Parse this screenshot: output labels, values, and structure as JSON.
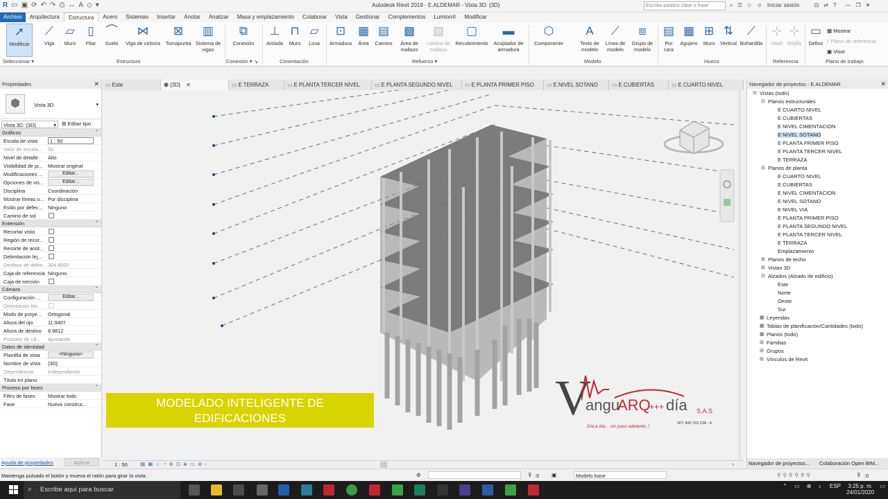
{
  "app": {
    "title": "Autodesk Revit 2019 - E.ALDEMAR - Vista 3D: {3D}",
    "search_placeholder": "Escriba palabra clave o frase",
    "sign_in": "Iniciar sesión"
  },
  "menu": [
    "Archivo",
    "Arquitectura",
    "Estructura",
    "Acero",
    "Sistemas",
    "Insertar",
    "Anotar",
    "Analizar",
    "Masa y emplazamiento",
    "Colaborar",
    "Vista",
    "Gestionar",
    "Complementos",
    "Lumion®",
    "Modificar"
  ],
  "ribbon": {
    "tools": [
      "Modificar",
      "Viga",
      "Muro",
      "Pilar",
      "Suelo",
      "Viga de celosía",
      "Tornapunta",
      "Sistema de vigas",
      "Conexión",
      "Aislada",
      "Muro",
      "Losa",
      "Armadura",
      "Área",
      "Camino",
      "Área de mallazo",
      "Lámina de mallazo",
      "Recubrimiento",
      "Acoplador de armadura",
      "Componente",
      "Texto de modelo",
      "Línea de modelo",
      "Grupo de modelo",
      "Por cara",
      "Agujero",
      "Muro",
      "Vertical",
      "Buhardilla",
      "Nivel",
      "Rejilla",
      "Definir",
      "Mostrar",
      "Plano de referencia",
      "Visor"
    ],
    "groups": [
      "Seleccionar",
      "Estructura",
      "Conexión",
      "Cimentación",
      "Refuerzo",
      "Modelo",
      "Hueco",
      "Referencia",
      "Plano de trabajo"
    ]
  },
  "properties": {
    "title": "Propiedades",
    "type_name": "Vista 3D",
    "instance_selector": "Vista 3D: {3D}",
    "edit_type": "Editar tipo",
    "sections": [
      {
        "name": "Gráficos",
        "rows": [
          {
            "k": "Escala de vista",
            "v": "1 : 50",
            "kind": "input"
          },
          {
            "k": "Valor de escala...",
            "v": "50",
            "kind": "grey"
          },
          {
            "k": "Nivel de detalle",
            "v": "Alto"
          },
          {
            "k": "Visibilidad de pi...",
            "v": "Mostrar original"
          },
          {
            "k": "Modificaciones ...",
            "v": "Editar...",
            "kind": "btn"
          },
          {
            "k": "Opciones de vis...",
            "v": "Editar...",
            "kind": "btn"
          },
          {
            "k": "Disciplina",
            "v": "Coordinación"
          },
          {
            "k": "Mostrar líneas o...",
            "v": "Por disciplina"
          },
          {
            "k": "Estilo por defec...",
            "v": "Ninguno"
          },
          {
            "k": "Camino de sol",
            "v": "",
            "kind": "chk"
          }
        ]
      },
      {
        "name": "Extensión",
        "rows": [
          {
            "k": "Recortar vista",
            "v": "",
            "kind": "chk"
          },
          {
            "k": "Región de recor...",
            "v": "",
            "kind": "chk"
          },
          {
            "k": "Recorte de anot...",
            "v": "",
            "kind": "chk"
          },
          {
            "k": "Delimitación lej...",
            "v": "",
            "kind": "chk"
          },
          {
            "k": "Desfase de delim...",
            "v": "304.8000",
            "kind": "grey"
          },
          {
            "k": "Caja de referencia",
            "v": "Ninguno"
          },
          {
            "k": "Caja de sección",
            "v": "",
            "kind": "chk"
          }
        ]
      },
      {
        "name": "Cámara",
        "rows": [
          {
            "k": "Configuración ...",
            "v": "Editar...",
            "kind": "btn"
          },
          {
            "k": "Orientación blo...",
            "v": "",
            "kind": "greychk"
          },
          {
            "k": "Modo de proye...",
            "v": "Ortogonal"
          },
          {
            "k": "Altura del ojo",
            "v": "11.9407"
          },
          {
            "k": "Altura de destino",
            "v": "8.9812"
          },
          {
            "k": "Posición de cá...",
            "v": "Ajustando",
            "kind": "grey"
          }
        ]
      },
      {
        "name": "Datos de identidad",
        "rows": [
          {
            "k": "Plantilla de vista",
            "v": "<Ninguno>",
            "kind": "btn"
          },
          {
            "k": "Nombre de vista",
            "v": "{3D}"
          },
          {
            "k": "Dependencia",
            "v": "Independiente",
            "kind": "grey"
          },
          {
            "k": "Título en plano",
            "v": ""
          }
        ]
      },
      {
        "name": "Proceso por fases",
        "rows": [
          {
            "k": "Filtro de fases",
            "v": "Mostrar todo"
          },
          {
            "k": "Fase",
            "v": "Nueva construc..."
          }
        ]
      }
    ],
    "help_link": "Ayuda de propiedades",
    "apply": "Aplicar"
  },
  "view_tabs": [
    "Este",
    "{3D}",
    "E TERRAZA",
    "E PLANTA TERCER NIVEL",
    "E PLANTA SEGUNDO NIVEL",
    "E PLANTA PRIMER PISO",
    "E NIVEL SOTANO",
    "E CUBIERTAS",
    "E CUARTO NIVEL"
  ],
  "canvas": {
    "banner_line1": "MODELADO INTELIGENTE DE",
    "banner_line2": "EDIFICACIONES",
    "logo_v": "V",
    "logo_angu": "angu",
    "logo_arq": "ARQ",
    "logo_plus": "+++",
    "logo_dia": "día",
    "logo_sas": "S.A.S",
    "logo_tagline": "Día a día... Un paso adelante..!",
    "logo_nit": "NIT: 900 763 238 - 4"
  },
  "view_control": {
    "scale": "1 : 50"
  },
  "browser": {
    "title": "Navegador de proyectos - E.ALDEMAR",
    "nodes": [
      {
        "label": "Vistas (todo)",
        "lvl": 0,
        "tg": "⊟"
      },
      {
        "label": "Planos estructurales",
        "lvl": 1,
        "tg": "⊟"
      },
      {
        "label": "E CUARTO NIVEL",
        "lvl": 2
      },
      {
        "label": "E CUBIERTAS",
        "lvl": 2
      },
      {
        "label": "E NIVEL CIMENTACION",
        "lvl": 2
      },
      {
        "label": "E NIVEL SOTANO",
        "lvl": 2,
        "hl": true
      },
      {
        "label": "E PLANTA PRIMER PISO",
        "lvl": 2
      },
      {
        "label": "E PLANTA TERCER NIVEL",
        "lvl": 2
      },
      {
        "label": "E TERRAZA",
        "lvl": 2
      },
      {
        "label": "Planos de planta",
        "lvl": 1,
        "tg": "⊟"
      },
      {
        "label": "E CUARTO NIVEL",
        "lvl": 2
      },
      {
        "label": "E CUBIERTAS",
        "lvl": 2
      },
      {
        "label": "E NIVEL CIMENTACION",
        "lvl": 2
      },
      {
        "label": "E NIVEL SOTANO",
        "lvl": 2
      },
      {
        "label": "E NIVEL VIA",
        "lvl": 2
      },
      {
        "label": "E PLANTA PRIMER PISO",
        "lvl": 2
      },
      {
        "label": "E PLANTA SEGUNDO NIVEL",
        "lvl": 2
      },
      {
        "label": "E PLANTA TERCER NIVEL",
        "lvl": 2
      },
      {
        "label": "E TERRAZA",
        "lvl": 2
      },
      {
        "label": "Emplazamiento",
        "lvl": 2
      },
      {
        "label": "Planos de techo",
        "lvl": 1,
        "tg": "⊞"
      },
      {
        "label": "Vistas 3D",
        "lvl": 1,
        "tg": "⊞"
      },
      {
        "label": "Alzados (Alzado de edificio)",
        "lvl": 1,
        "tg": "⊟"
      },
      {
        "label": "Este",
        "lvl": 2
      },
      {
        "label": "Norte",
        "lvl": 2
      },
      {
        "label": "Oeste",
        "lvl": 2
      },
      {
        "label": "Sur",
        "lvl": 2
      },
      {
        "label": "Leyendas",
        "lvl": 0,
        "tg": "▦"
      },
      {
        "label": "Tablas de planificación/Cantidades (todo)",
        "lvl": 0,
        "tg": "▦"
      },
      {
        "label": "Planos (todo)",
        "lvl": 0,
        "tg": "▦"
      },
      {
        "label": "Familias",
        "lvl": 0,
        "tg": "⊞"
      },
      {
        "label": "Grupos",
        "lvl": 0,
        "tg": "⊞"
      },
      {
        "label": "Vínculos de Revit",
        "lvl": 0,
        "tg": "⊞"
      }
    ],
    "tab1": "Navegador de proyectos...",
    "tab2": "Colaboración Open BIM..."
  },
  "status": {
    "hint": "Mantenga pulsado el botón y mueva el ratón para girar la vista.",
    "filter_count": ":0",
    "model": "Modelo base",
    "select_count": ":0"
  },
  "taskbar": {
    "search": "Escribe aquí para buscar",
    "lang": "ESP",
    "time": "3:25 p. m.",
    "date": "24/01/2020"
  }
}
